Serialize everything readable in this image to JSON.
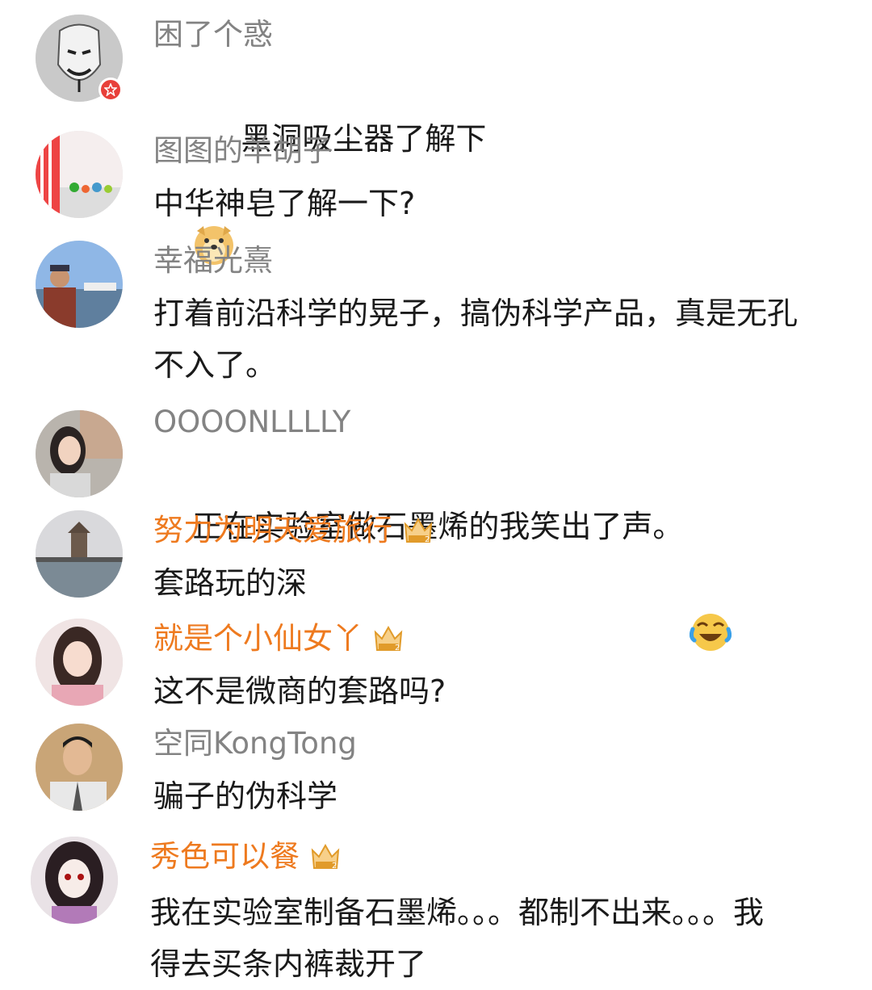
{
  "comments": [
    {
      "name": "困了个惑",
      "text": "黑洞吸尘器了解下",
      "emoji_prefix": "doge-emoji",
      "vip": false,
      "verified": true
    },
    {
      "name": "图图的羊胡子",
      "text": "中华神皂了解一下?",
      "vip": false
    },
    {
      "name": "幸福光熹",
      "text": "打着前沿科学的晃子，搞伪科学产品，真是无孔不入了。",
      "vip": false
    },
    {
      "name": "OOOONLLLLY",
      "text": "正在实验室做石墨烯的我笑出了声。",
      "emoji_suffix": "laugh-cry-emoji",
      "vip": false
    },
    {
      "name": "努力为明天爱旅行",
      "text": "套路玩的深",
      "vip": true
    },
    {
      "name": "就是个小仙女丫",
      "text": "这不是微商的套路吗?",
      "vip": true
    },
    {
      "name": "空同KongTong",
      "text": "骗子的伪科学",
      "vip": false
    },
    {
      "name": "秀色可以餐",
      "text": "我在实验室制备石墨烯。。。都制不出来。。。我得去买条内裤裁开了",
      "vip": true
    }
  ],
  "colors": {
    "name_gray": "#838383",
    "name_vip": "#ee7a1f",
    "text": "#1a1a1a",
    "verified_badge": "#e8403a"
  }
}
